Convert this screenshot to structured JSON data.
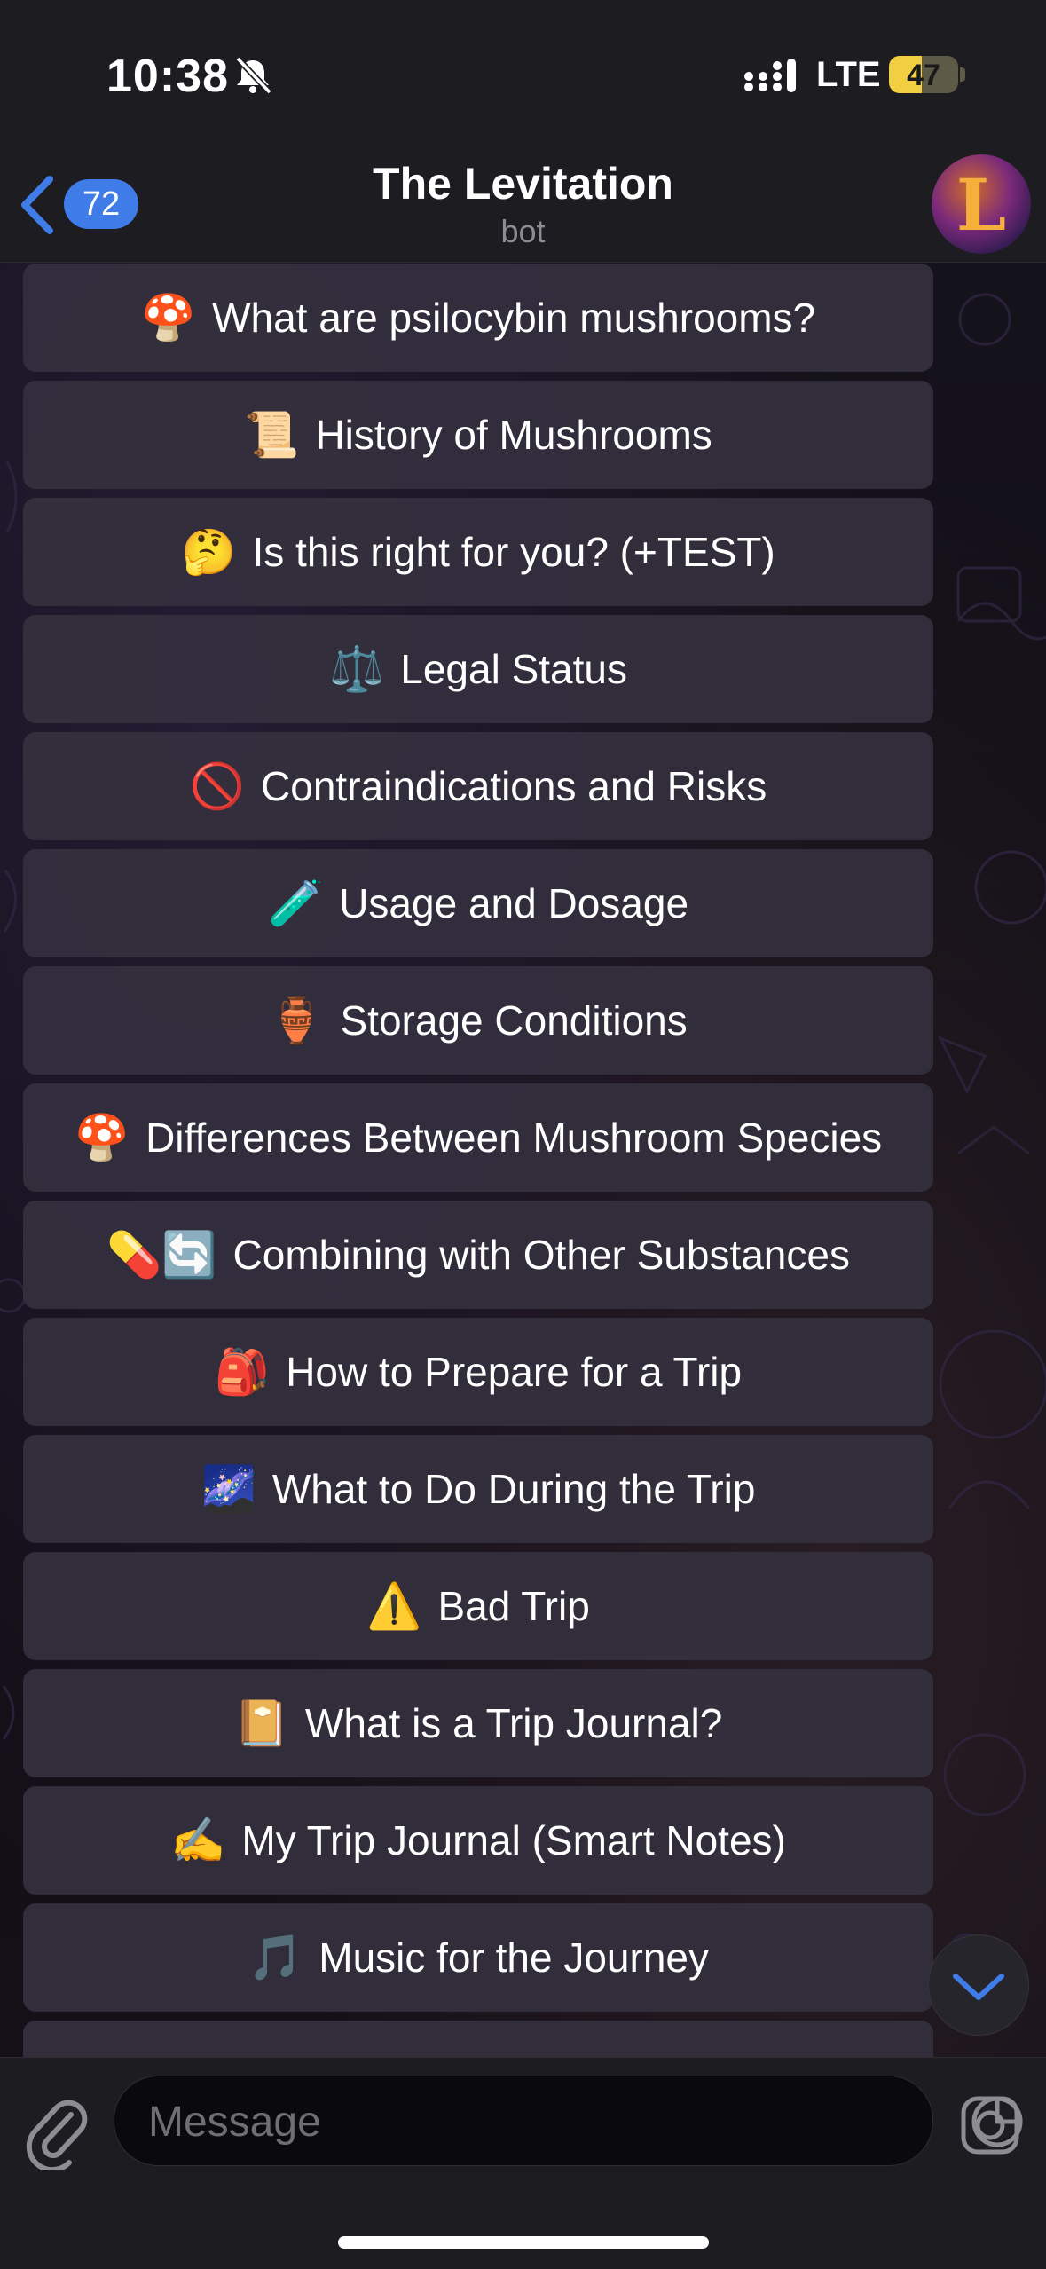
{
  "status": {
    "time": "10:38",
    "network": "LTE",
    "battery": "47"
  },
  "header": {
    "back_badge": "72",
    "title": "The Levitation",
    "subtitle": "bot",
    "avatar_letter": "L"
  },
  "menu": [
    {
      "icon": "🍄",
      "label": "What are psilocybin mushrooms?"
    },
    {
      "icon": "📜",
      "label": "History of Mushrooms"
    },
    {
      "icon": "🤔",
      "label": "Is this right for you? (+TEST)"
    },
    {
      "icon": "⚖️",
      "label": "Legal Status"
    },
    {
      "icon": "🚫",
      "label": "Contraindications and Risks"
    },
    {
      "icon": "🧪",
      "label": "Usage and Dosage"
    },
    {
      "icon": "🏺",
      "label": "Storage Conditions"
    },
    {
      "icon": "🍄",
      "label": "Differences Between Mushroom Species"
    },
    {
      "icon": "💊🔄",
      "label": "Combining with Other Substances"
    },
    {
      "icon": "🎒",
      "label": "How to Prepare for a Trip"
    },
    {
      "icon": "🌌",
      "label": "What to Do During the Trip"
    },
    {
      "icon": "⚠️",
      "label": "Bad Trip"
    },
    {
      "icon": "📔",
      "label": "What is a Trip Journal?"
    },
    {
      "icon": "✍️",
      "label": "My Trip Journal (Smart Notes)"
    },
    {
      "icon": "🎵",
      "label": "Music for the Journey"
    },
    {
      "icon": "",
      "label": ""
    }
  ],
  "composer": {
    "placeholder": "Message"
  },
  "colors": {
    "accent": "#3f7ce8",
    "button_bg": "#34303e",
    "bar_bg": "#1d1c21"
  },
  "icons": [
    "bell-slash-icon",
    "signal-icon",
    "chevron-left-icon",
    "paperclip-icon",
    "sticker-icon",
    "camera-icon",
    "chevron-down-icon"
  ]
}
